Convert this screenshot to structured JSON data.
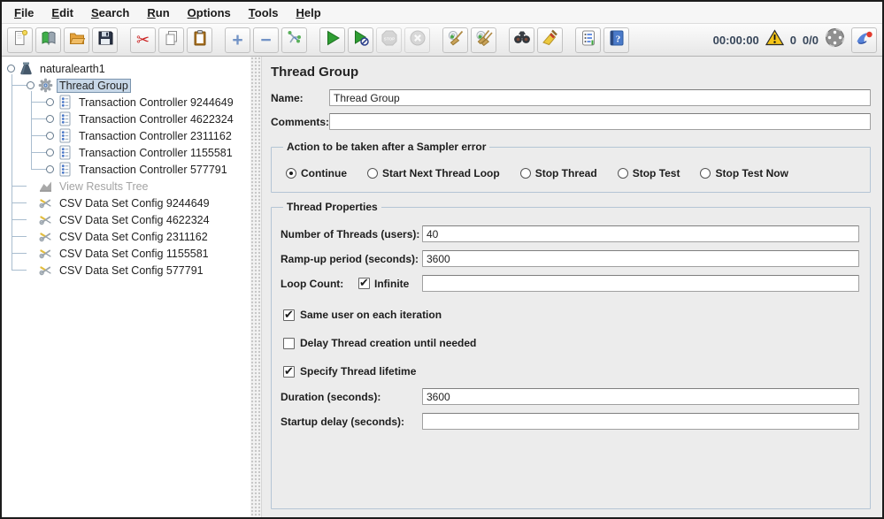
{
  "menu": {
    "items": [
      {
        "label": "File"
      },
      {
        "label": "Edit"
      },
      {
        "label": "Search"
      },
      {
        "label": "Run"
      },
      {
        "label": "Options"
      },
      {
        "label": "Tools"
      },
      {
        "label": "Help"
      }
    ]
  },
  "toolbar": {
    "icons": [
      "new-file",
      "templates",
      "open-folder",
      "save",
      "cut",
      "copy",
      "paste",
      "add",
      "remove",
      "toggle-elements",
      "start",
      "start-no-pauses",
      "stop",
      "shutdown",
      "clear",
      "clear-all",
      "search",
      "search-reset",
      "function-helper",
      "help",
      "warning",
      "remote-indicator",
      "jmeter-logo"
    ],
    "status": {
      "elapsed_time": "00:00:00",
      "warning_count": "0",
      "thread_ratio": "0/0"
    }
  },
  "tree": {
    "items": [
      {
        "label": "naturalearth1",
        "depth": 0,
        "icon": "test-plan",
        "handle": "expanded"
      },
      {
        "label": "Thread Group",
        "depth": 1,
        "icon": "thread-group",
        "handle": "expanded",
        "selected": true
      },
      {
        "label": "Transaction Controller 9244649",
        "depth": 2,
        "icon": "transaction-controller",
        "handle": "collapsed"
      },
      {
        "label": "Transaction Controller 4622324",
        "depth": 2,
        "icon": "transaction-controller",
        "handle": "collapsed"
      },
      {
        "label": "Transaction Controller 2311162",
        "depth": 2,
        "icon": "transaction-controller",
        "handle": "collapsed"
      },
      {
        "label": "Transaction Controller 1155581",
        "depth": 2,
        "icon": "transaction-controller",
        "handle": "collapsed"
      },
      {
        "label": "Transaction Controller 577791",
        "depth": 2,
        "icon": "transaction-controller",
        "handle": "collapsed"
      },
      {
        "label": "View Results Tree",
        "depth": 1,
        "icon": "results-tree",
        "handle": "leaf",
        "disabled": true
      },
      {
        "label": "CSV Data Set Config 9244649",
        "depth": 1,
        "icon": "csv-config",
        "handle": "leaf"
      },
      {
        "label": "CSV Data Set Config 4622324",
        "depth": 1,
        "icon": "csv-config",
        "handle": "leaf"
      },
      {
        "label": "CSV Data Set Config 2311162",
        "depth": 1,
        "icon": "csv-config",
        "handle": "leaf"
      },
      {
        "label": "CSV Data Set Config 1155581",
        "depth": 1,
        "icon": "csv-config",
        "handle": "leaf"
      },
      {
        "label": "CSV Data Set Config 577791",
        "depth": 1,
        "icon": "csv-config",
        "handle": "leaf"
      }
    ]
  },
  "main": {
    "title": "Thread Group",
    "name": {
      "label": "Name:",
      "value": "Thread Group"
    },
    "comments": {
      "label": "Comments:",
      "value": ""
    },
    "action_group": {
      "legend": "Action to be taken after a Sampler error",
      "options": [
        {
          "label": "Continue",
          "selected": true
        },
        {
          "label": "Start Next Thread Loop",
          "selected": false
        },
        {
          "label": "Stop Thread",
          "selected": false
        },
        {
          "label": "Stop Test",
          "selected": false
        },
        {
          "label": "Stop Test Now",
          "selected": false
        }
      ]
    },
    "thread_props": {
      "legend": "Thread Properties",
      "num_threads": {
        "label": "Number of Threads (users):",
        "value": "40"
      },
      "rampup": {
        "label": "Ramp-up period (seconds):",
        "value": "3600"
      },
      "loop": {
        "label": "Loop Count:",
        "infinite_label": "Infinite",
        "infinite_checked": true,
        "value": ""
      },
      "cb_same_user": {
        "label": "Same user on each iteration",
        "checked": true
      },
      "cb_delay": {
        "label": "Delay Thread creation until needed",
        "checked": false
      },
      "cb_lifetime": {
        "label": "Specify Thread lifetime",
        "checked": true
      },
      "duration": {
        "label": "Duration (seconds):",
        "value": "3600"
      },
      "startup": {
        "label": "Startup delay (seconds):",
        "value": ""
      }
    }
  }
}
